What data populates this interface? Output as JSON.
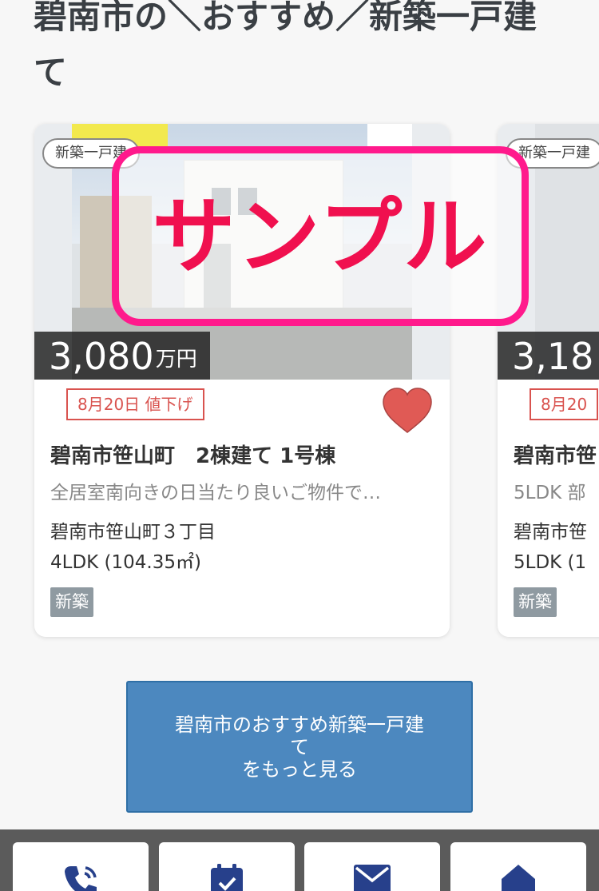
{
  "section": {
    "title": "碧南市の＼おすすめ／新築一戸建て"
  },
  "cards": [
    {
      "type_tag": "新築一戸建",
      "price_num": "3,080",
      "price_unit": "万円",
      "date_tag": "8月20日 値下げ",
      "name": "碧南市笹山町　2棟建て 1号棟",
      "description": "全居室南向きの日当たり良いご物件で…",
      "address": "碧南市笹山町３丁目",
      "layout": "4LDK (104.35㎡)",
      "badge": "新築",
      "favorite_icon": "heart-icon"
    },
    {
      "type_tag": "新築一戸建",
      "price_num": "3,18",
      "date_tag": "8月20",
      "name": "碧南市笹",
      "description": "5LDK 部",
      "address": "碧南市笹",
      "layout": "5LDK (1",
      "badge": "新築"
    }
  ],
  "overlay": {
    "text": "サンプル"
  },
  "more_button": {
    "label": "碧南市のおすすめ新築一戸建\nて\nをもっと見る"
  },
  "bottom_nav": {
    "icons": [
      "phone-icon",
      "calendar-icon",
      "mail-icon",
      "home-icon"
    ]
  },
  "colors": {
    "accent_blue": "#4c88bf",
    "price_red": "#d9534f",
    "overlay_pink": "#ff1a8c",
    "overlay_text": "#f0104f",
    "nav_icon": "#27408b"
  }
}
